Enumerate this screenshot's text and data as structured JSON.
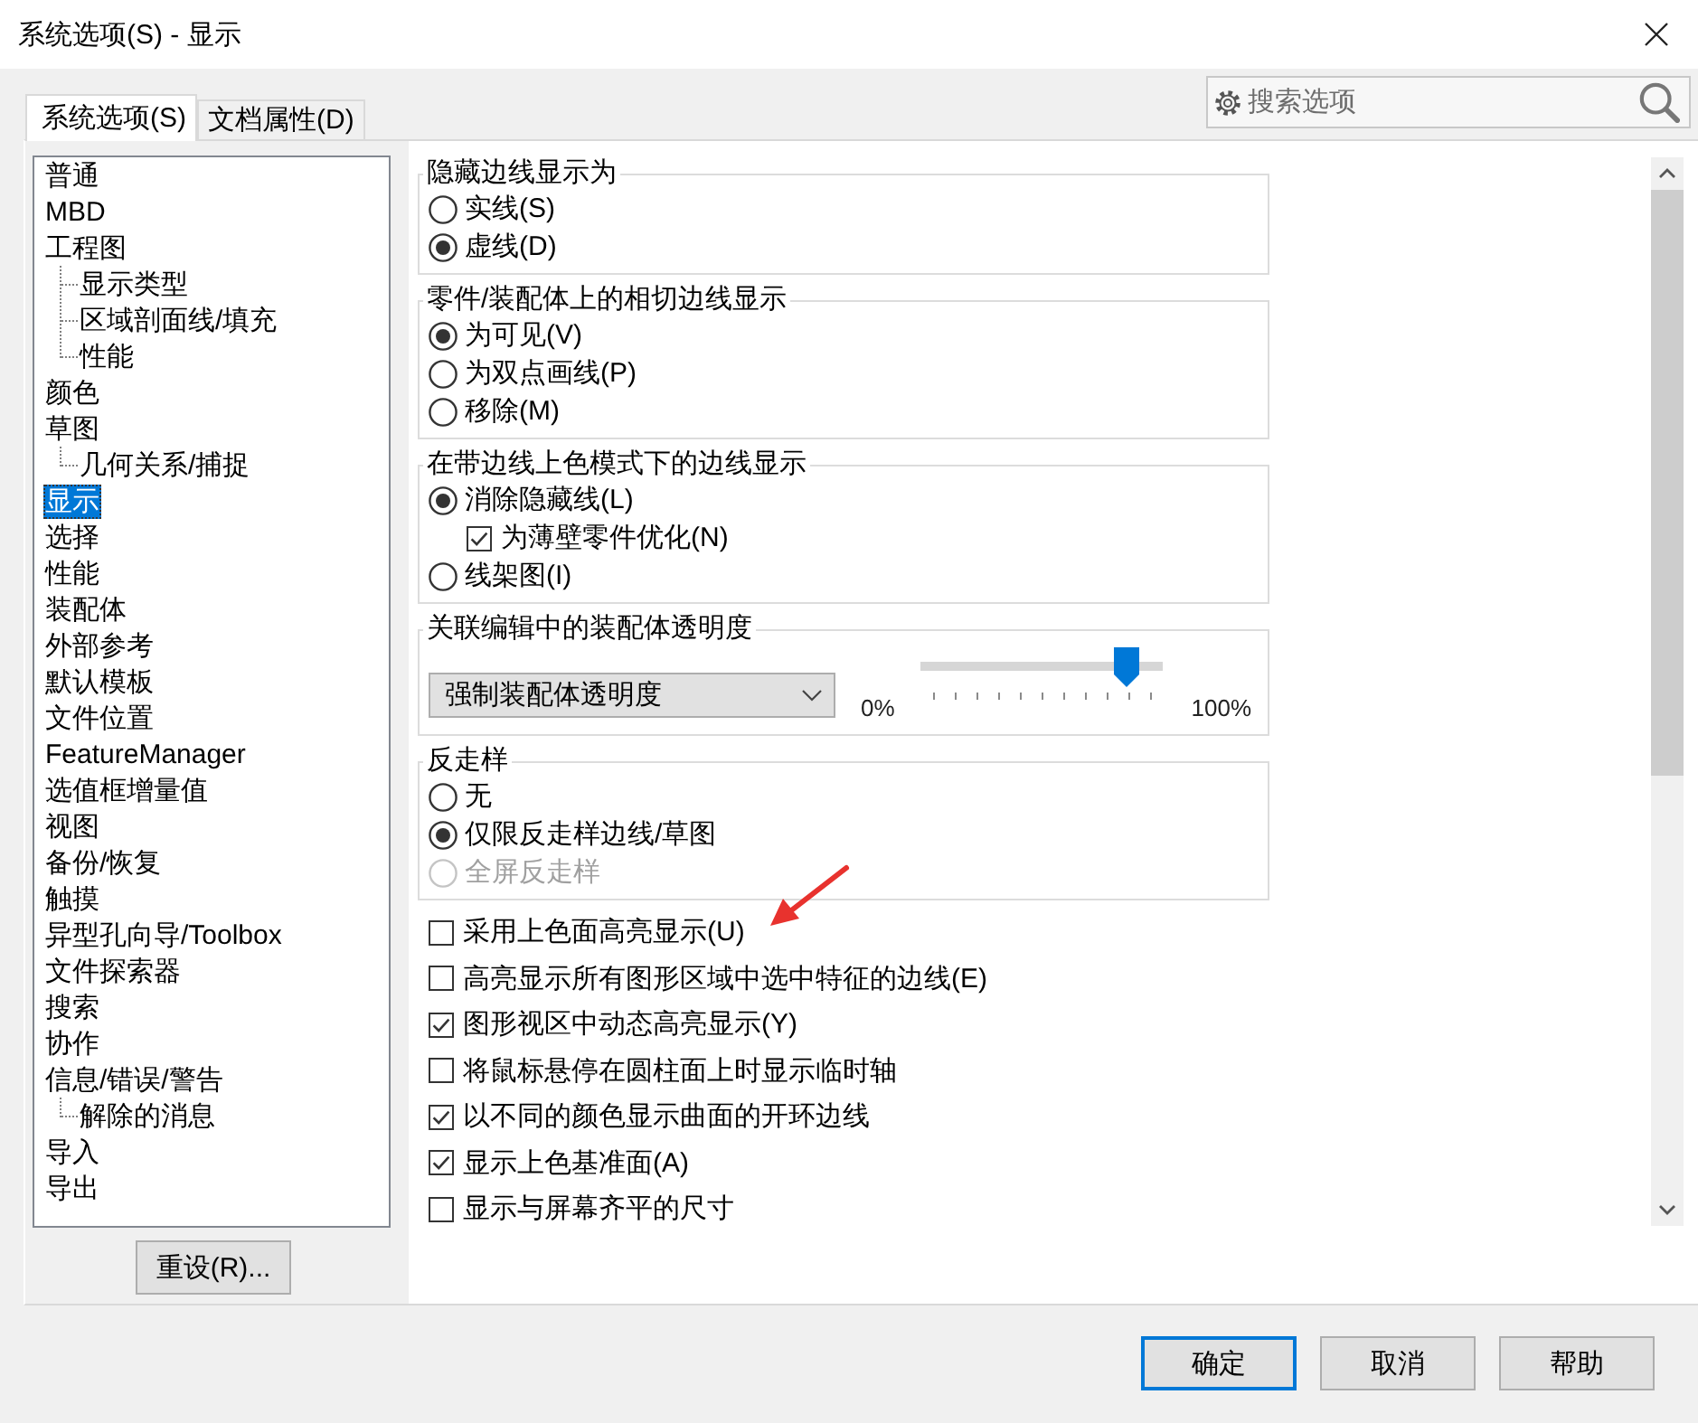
{
  "window": {
    "title": "系统选项(S) - 显示"
  },
  "tabs": [
    {
      "label": "系统选项(S)",
      "selected": true
    },
    {
      "label": "文档属性(D)",
      "selected": false
    }
  ],
  "search": {
    "placeholder": "搜索选项"
  },
  "tree": {
    "items": [
      {
        "label": "普通",
        "selected": false
      },
      {
        "label": "MBD",
        "selected": false
      },
      {
        "label": "工程图",
        "selected": false,
        "children": [
          {
            "label": "显示类型",
            "selected": false
          },
          {
            "label": "区域剖面线/填充",
            "selected": false
          },
          {
            "label": "性能",
            "selected": false
          }
        ]
      },
      {
        "label": "颜色",
        "selected": false
      },
      {
        "label": "草图",
        "selected": false,
        "children": [
          {
            "label": "几何关系/捕捉",
            "selected": false
          }
        ]
      },
      {
        "label": "显示",
        "selected": true
      },
      {
        "label": "选择",
        "selected": false
      },
      {
        "label": "性能",
        "selected": false
      },
      {
        "label": "装配体",
        "selected": false
      },
      {
        "label": "外部参考",
        "selected": false
      },
      {
        "label": "默认模板",
        "selected": false
      },
      {
        "label": "文件位置",
        "selected": false
      },
      {
        "label": "FeatureManager",
        "selected": false
      },
      {
        "label": "选值框增量值",
        "selected": false
      },
      {
        "label": "视图",
        "selected": false
      },
      {
        "label": "备份/恢复",
        "selected": false
      },
      {
        "label": "触摸",
        "selected": false
      },
      {
        "label": "异型孔向导/Toolbox",
        "selected": false
      },
      {
        "label": "文件探索器",
        "selected": false
      },
      {
        "label": "搜索",
        "selected": false
      },
      {
        "label": "协作",
        "selected": false
      },
      {
        "label": "信息/错误/警告",
        "selected": false,
        "children": [
          {
            "label": "解除的消息",
            "selected": false
          }
        ]
      },
      {
        "label": "导入",
        "selected": false
      },
      {
        "label": "导出",
        "selected": false
      }
    ]
  },
  "reset_button": {
    "label": "重设(R)..."
  },
  "groups": [
    {
      "kind": "radio",
      "title": "隐藏边线显示为",
      "options": [
        {
          "label": "实线(S)",
          "selected": false,
          "disabled": false
        },
        {
          "label": "虚线(D)",
          "selected": true,
          "disabled": false
        }
      ]
    },
    {
      "kind": "radio",
      "title": "零件/装配体上的相切边线显示",
      "options": [
        {
          "label": "为可见(V)",
          "selected": true,
          "disabled": false
        },
        {
          "label": "为双点画线(P)",
          "selected": false,
          "disabled": false
        },
        {
          "label": "移除(M)",
          "selected": false,
          "disabled": false
        }
      ]
    },
    {
      "kind": "radio",
      "title": "在带边线上色模式下的边线显示",
      "options": [
        {
          "label": "消除隐藏线(L)",
          "selected": true,
          "disabled": false,
          "children": [
            {
              "label": "为薄壁零件优化(N)",
              "checked": true
            }
          ]
        },
        {
          "label": "线架图(I)",
          "selected": false,
          "disabled": false
        }
      ]
    },
    {
      "kind": "transparency",
      "title": "关联编辑中的装配体透明度",
      "dropdown": {
        "value": "强制装配体透明度"
      },
      "slider": {
        "min_label": "0%",
        "max_label": "100%",
        "level": 0.85
      }
    },
    {
      "kind": "radio",
      "title": "反走样",
      "options": [
        {
          "label": "无",
          "selected": false,
          "disabled": false
        },
        {
          "label": "仅限反走样边线/草图",
          "selected": true,
          "disabled": false
        },
        {
          "label": "全屏反走样",
          "selected": false,
          "disabled": true
        }
      ]
    }
  ],
  "checkboxes": [
    {
      "label": "采用上色面高亮显示(U)",
      "checked": false
    },
    {
      "label": "高亮显示所有图形区域中选中特征的边线(E)",
      "checked": false
    },
    {
      "label": "图形视区中动态高亮显示(Y)",
      "checked": true
    },
    {
      "label": "将鼠标悬停在圆柱面上时显示临时轴",
      "checked": false
    },
    {
      "label": "以不同的颜色显示曲面的开环边线",
      "checked": true
    },
    {
      "label": "显示上色基准面(A)",
      "checked": true
    },
    {
      "label": "显示与屏幕齐平的尺寸",
      "checked": false
    }
  ],
  "buttons": [
    {
      "label": "确定",
      "default": true
    },
    {
      "label": "取消",
      "default": false
    },
    {
      "label": "帮助",
      "default": false
    }
  ]
}
